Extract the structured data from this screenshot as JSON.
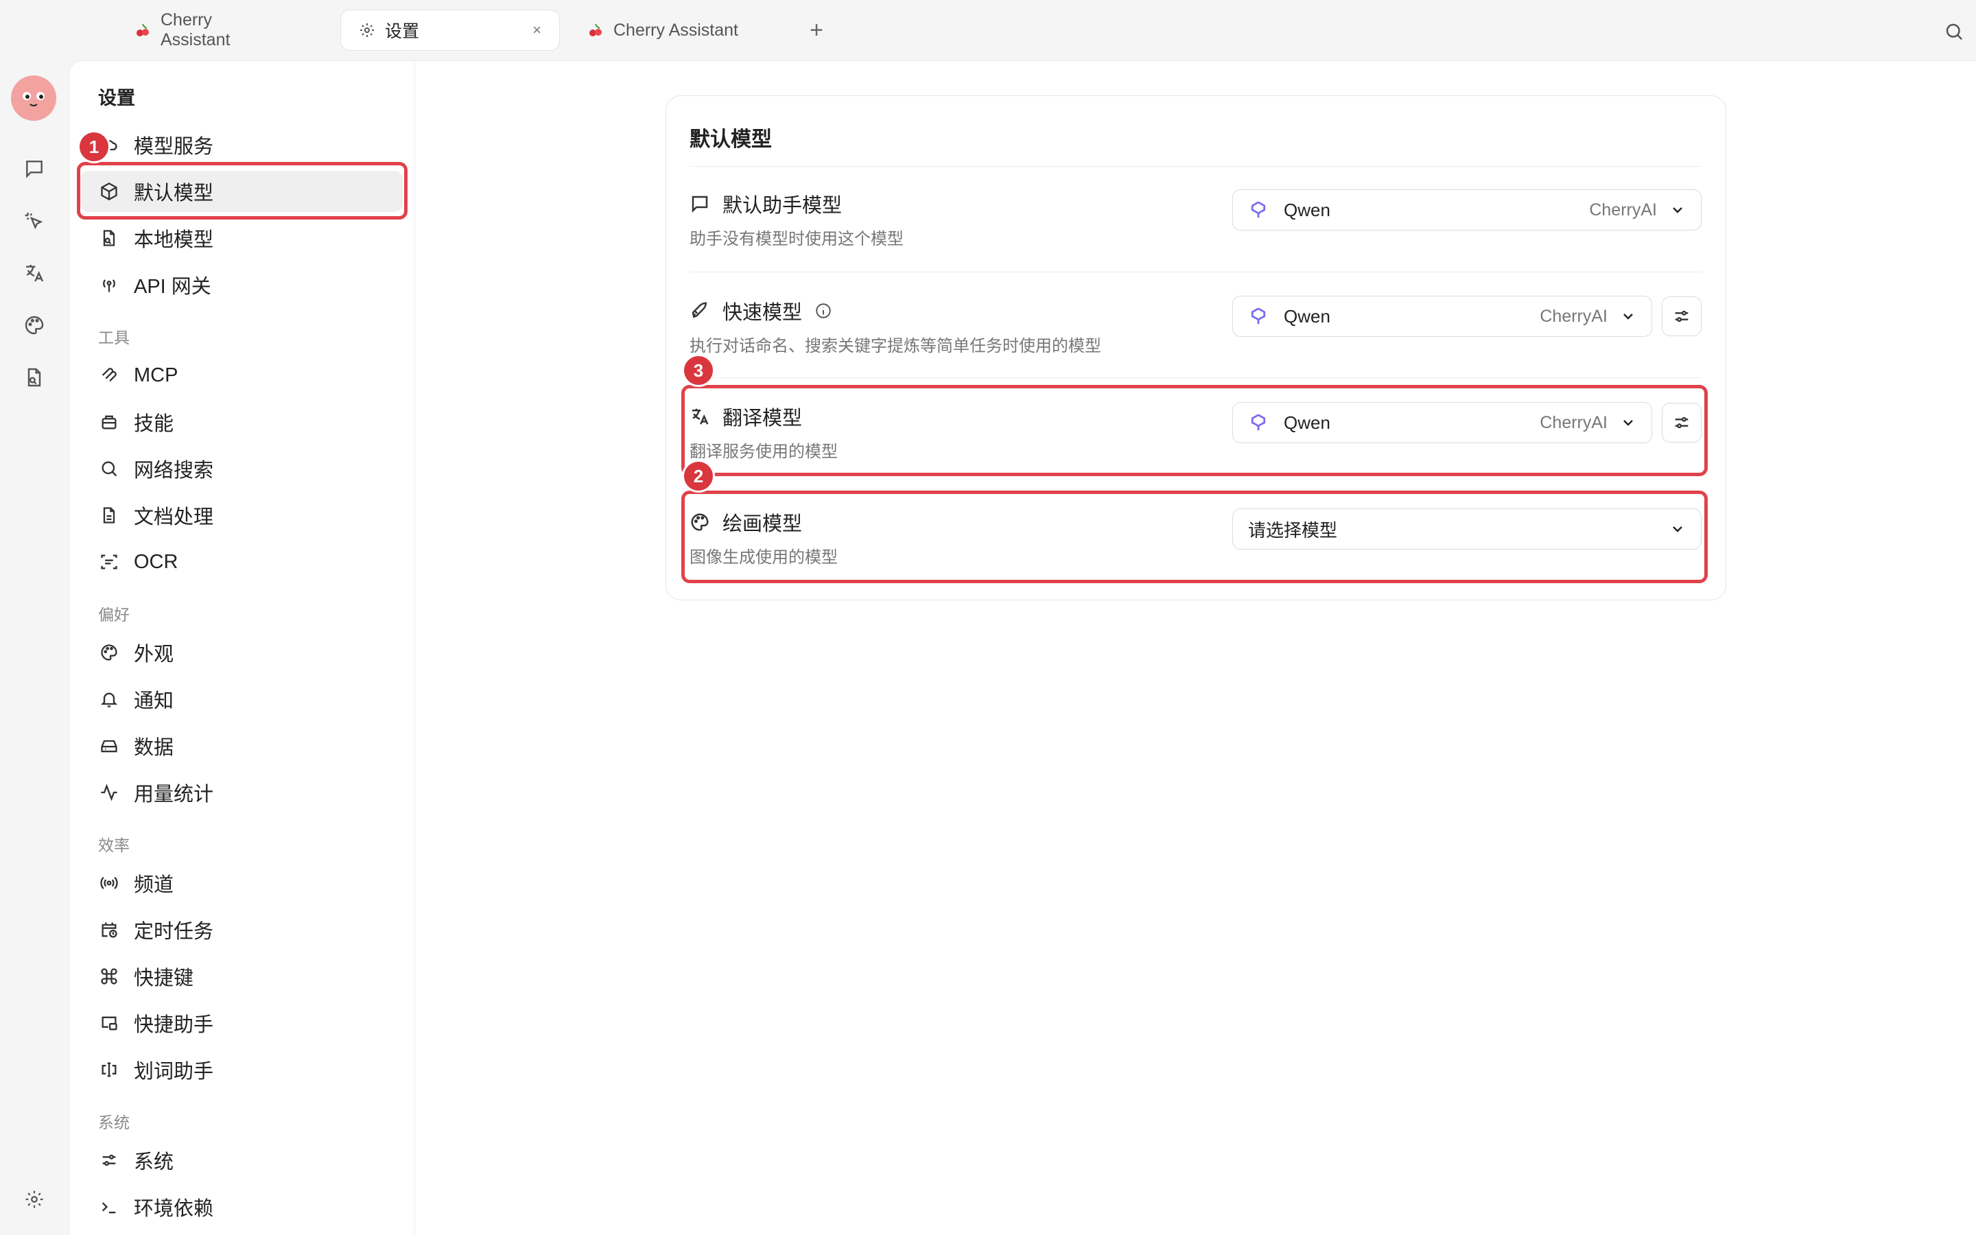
{
  "tabs": [
    {
      "label": "Cherry Assistant",
      "icon": "cherry-icon"
    },
    {
      "label": "设置",
      "icon": "gear-icon",
      "close": "×"
    },
    {
      "label": "Cherry Assistant",
      "icon": "cherry-icon"
    }
  ],
  "new_tab": "+",
  "sidebar": {
    "title": "设置",
    "items": [
      {
        "label": "模型服务",
        "icon": "cloud-icon"
      },
      {
        "label": "默认模型",
        "icon": "cube-icon"
      },
      {
        "label": "本地模型",
        "icon": "file-search-icon"
      },
      {
        "label": "API 网关",
        "icon": "broadcast-icon"
      }
    ],
    "groups": [
      {
        "title": "工具",
        "items": [
          {
            "label": "MCP",
            "icon": "mcp-icon"
          },
          {
            "label": "技能",
            "icon": "skill-icon"
          },
          {
            "label": "网络搜索",
            "icon": "search-icon"
          },
          {
            "label": "文档处理",
            "icon": "document-icon"
          },
          {
            "label": "OCR",
            "icon": "scan-icon"
          }
        ]
      },
      {
        "title": "偏好",
        "items": [
          {
            "label": "外观",
            "icon": "palette-icon"
          },
          {
            "label": "通知",
            "icon": "bell-icon"
          },
          {
            "label": "数据",
            "icon": "hard-drive-icon"
          },
          {
            "label": "用量统计",
            "icon": "activity-icon"
          }
        ]
      },
      {
        "title": "效率",
        "items": [
          {
            "label": "频道",
            "icon": "radio-icon"
          },
          {
            "label": "定时任务",
            "icon": "calendar-clock-icon"
          },
          {
            "label": "快捷键",
            "icon": "command-icon"
          },
          {
            "label": "快捷助手",
            "icon": "window-icon"
          },
          {
            "label": "划词助手",
            "icon": "text-cursor-icon"
          }
        ]
      },
      {
        "title": "系统",
        "items": [
          {
            "label": "系统",
            "icon": "sliders-icon"
          },
          {
            "label": "环境依赖",
            "icon": "terminal-icon"
          }
        ]
      }
    ]
  },
  "card": {
    "title": "默认模型",
    "rows": [
      {
        "label": "默认助手模型",
        "desc": "助手没有模型时使用这个模型",
        "model": "Qwen",
        "provider": "CherryAI",
        "icon": "message-icon"
      },
      {
        "label": "快速模型",
        "desc": "执行对话命名、搜索关键字提炼等简单任务时使用的模型",
        "model": "Qwen",
        "provider": "CherryAI",
        "icon": "rocket-icon"
      },
      {
        "label": "翻译模型",
        "desc": "翻译服务使用的模型",
        "model": "Qwen",
        "provider": "CherryAI",
        "icon": "translate-icon"
      },
      {
        "label": "绘画模型",
        "desc": "图像生成使用的模型",
        "placeholder": "请选择模型",
        "icon": "palette-icon"
      }
    ]
  },
  "annotations": {
    "b1": "1",
    "b2": "2",
    "b3": "3"
  },
  "colors": {
    "highlight": "#e0424b",
    "badge": "#d9363e",
    "qwen": "#7b6cf0"
  }
}
